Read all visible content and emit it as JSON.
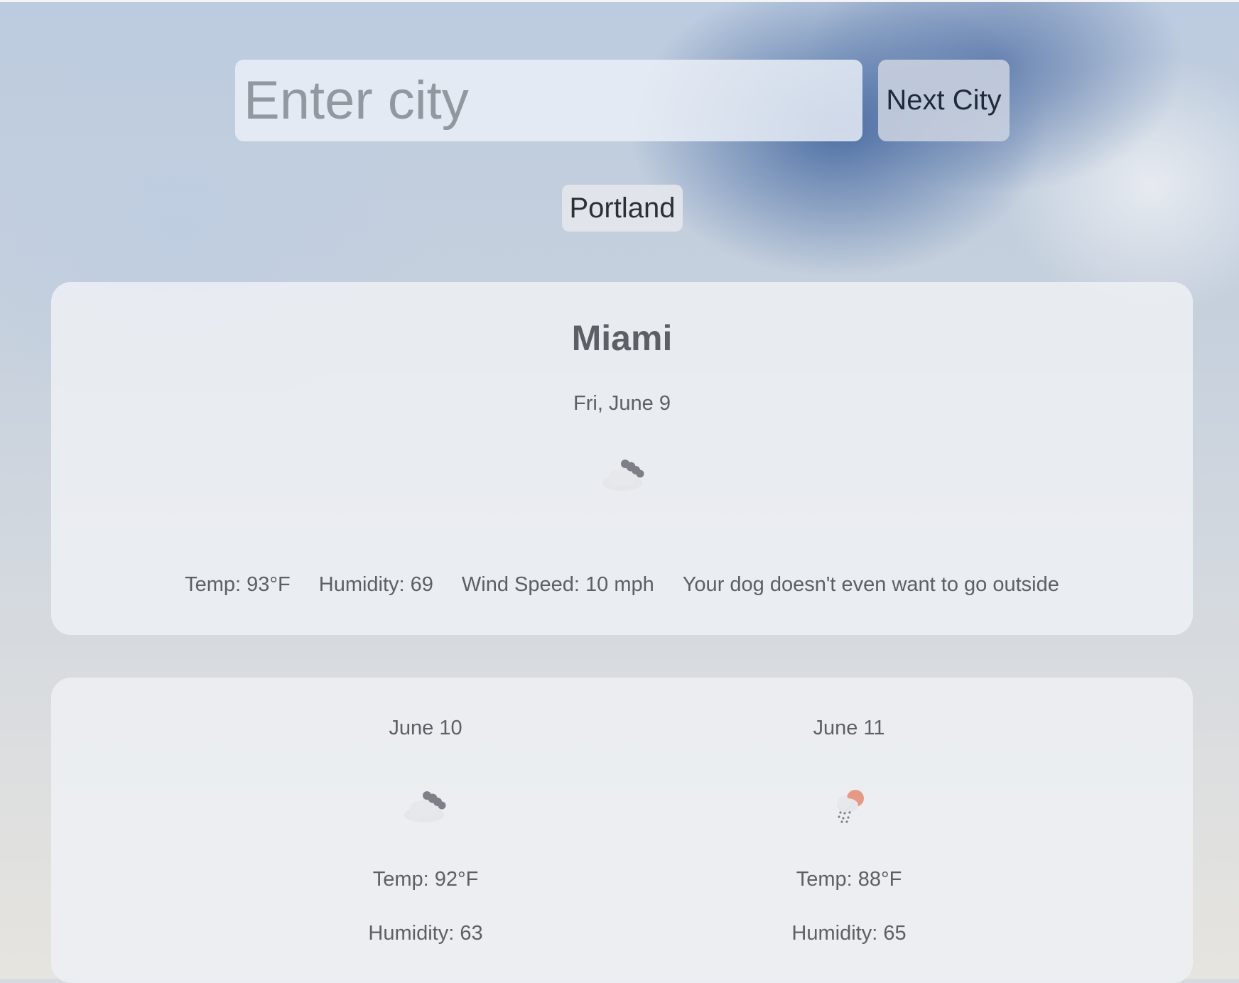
{
  "search": {
    "placeholder": "Enter city",
    "value": "",
    "button_label": "Next City"
  },
  "saved_cities": [
    "Portland"
  ],
  "current": {
    "city": "Miami",
    "date": "Fri, June 9",
    "icon": "cloudy-icon",
    "temp": "Temp: 93°F",
    "humidity": "Humidity: 69",
    "wind": "Wind Speed: 10 mph",
    "comment": "Your dog doesn't even want to go outside"
  },
  "forecast": [
    {
      "date": "June 10",
      "icon": "cloudy-icon",
      "temp": "Temp: 92°F",
      "humidity": "Humidity: 63"
    },
    {
      "date": "June 11",
      "icon": "sun-rain-icon",
      "temp": "Temp: 88°F",
      "humidity": "Humidity: 65"
    }
  ],
  "colors": {
    "card_bg": "#eef0f3",
    "text": "#5c6066",
    "button_text": "#1f2b3a",
    "sun": "#e69a86",
    "cloud_dark": "#7d8086",
    "cloud_light": "#e4e6ea"
  }
}
